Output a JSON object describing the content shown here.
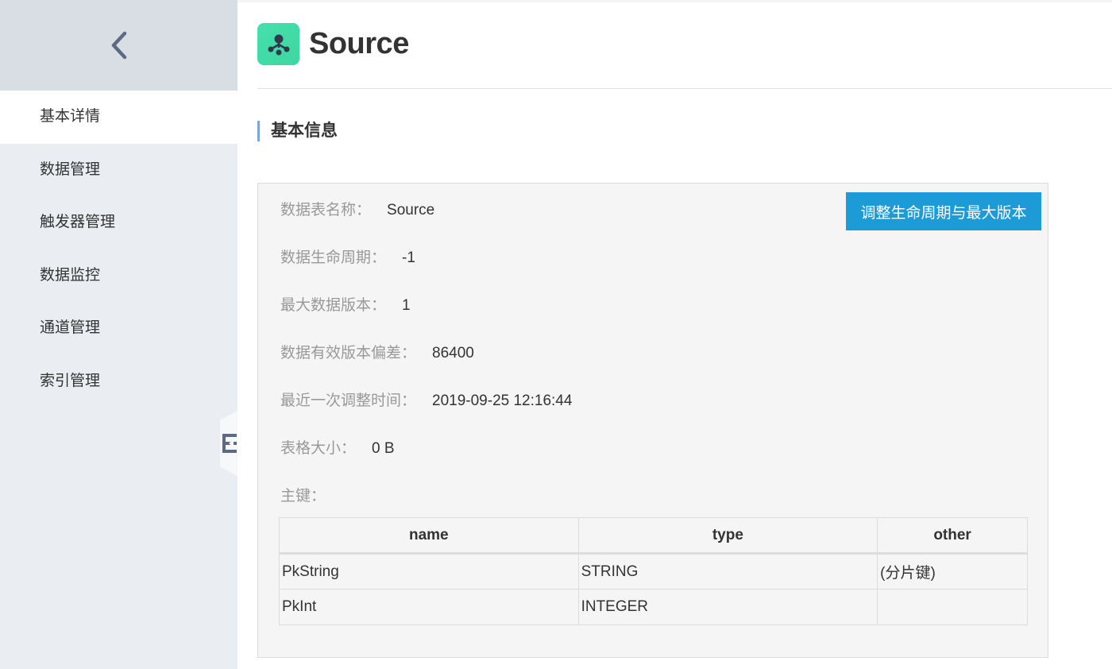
{
  "sidebar": {
    "back_icon": "chevron-left-icon",
    "collapse_icon": "collapse-menu-icon",
    "items": [
      {
        "label": "基本详情",
        "active": true
      },
      {
        "label": "数据管理",
        "active": false
      },
      {
        "label": "触发器管理",
        "active": false
      },
      {
        "label": "数据监控",
        "active": false
      },
      {
        "label": "通道管理",
        "active": false
      },
      {
        "label": "索引管理",
        "active": false
      }
    ]
  },
  "header": {
    "title": "Source",
    "logo_icon": "table-store-icon"
  },
  "section": {
    "title": "基本信息"
  },
  "info": {
    "adjust_button": "调整生命周期与最大版本",
    "fields": [
      {
        "label": "数据表名称：",
        "value": "Source"
      },
      {
        "label": "数据生命周期：",
        "value": "-1"
      },
      {
        "label": "最大数据版本：",
        "value": "1"
      },
      {
        "label": "数据有效版本偏差：",
        "value": "86400"
      },
      {
        "label": "最近一次调整时间：",
        "value": "2019-09-25 12:16:44"
      },
      {
        "label": "表格大小：",
        "value": "0 B"
      }
    ],
    "primary_key_label": "主键：",
    "primary_key_table": {
      "columns": [
        "name",
        "type",
        "other"
      ],
      "rows": [
        [
          "PkString",
          "STRING",
          "(分片键)"
        ],
        [
          "PkInt",
          "INTEGER",
          ""
        ]
      ]
    }
  },
  "colors": {
    "accent_button": "#1c9bd6",
    "logo": "#46e0ae",
    "sidebar_bg": "#eaedf1",
    "section_marker": "#7aa6d6"
  }
}
